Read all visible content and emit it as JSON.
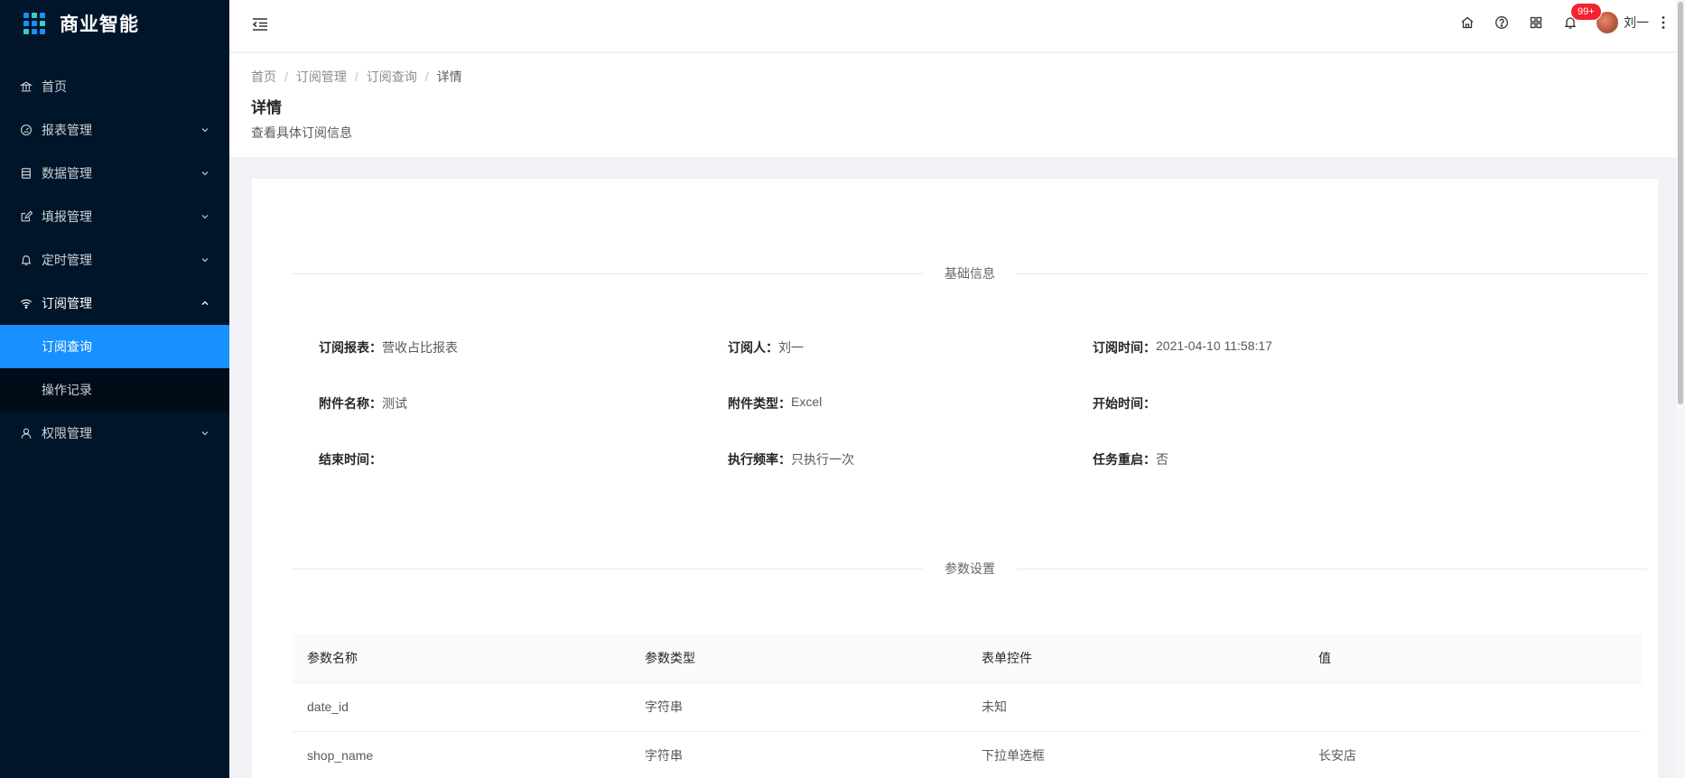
{
  "app": {
    "title": "商业智能"
  },
  "sidebar": {
    "items": [
      {
        "label": "首页",
        "icon": "bank-icon"
      },
      {
        "label": "报表管理",
        "icon": "dashboard-icon"
      },
      {
        "label": "数据管理",
        "icon": "database-icon"
      },
      {
        "label": "填报管理",
        "icon": "form-icon"
      },
      {
        "label": "定时管理",
        "icon": "bell-icon"
      },
      {
        "label": "订阅管理",
        "icon": "wifi-icon"
      },
      {
        "label": "权限管理",
        "icon": "user-icon"
      }
    ],
    "subitems": [
      {
        "label": "订阅查询"
      },
      {
        "label": "操作记录"
      }
    ]
  },
  "header": {
    "notification_count": "99+",
    "user_name": "刘一"
  },
  "breadcrumb": [
    "首页",
    "订阅管理",
    "订阅查询",
    "详情"
  ],
  "page": {
    "title": "详情",
    "description": "查看具体订阅信息"
  },
  "basic_info": {
    "section_title": "基础信息",
    "fields": [
      {
        "label": "订阅报表：",
        "value": "营收占比报表"
      },
      {
        "label": "订阅人：",
        "value": "刘一"
      },
      {
        "label": "订阅时间：",
        "value": "2021-04-10 11:58:17"
      },
      {
        "label": "附件名称：",
        "value": "测试"
      },
      {
        "label": "附件类型：",
        "value": "Excel"
      },
      {
        "label": "开始时间：",
        "value": ""
      },
      {
        "label": "结束时间：",
        "value": ""
      },
      {
        "label": "执行频率：",
        "value": "只执行一次"
      },
      {
        "label": "任务重启：",
        "value": "否"
      }
    ]
  },
  "params": {
    "section_title": "参数设置",
    "columns": [
      "参数名称",
      "参数类型",
      "表单控件",
      "值"
    ],
    "rows": [
      [
        "date_id",
        "字符串",
        "未知",
        ""
      ],
      [
        "shop_name",
        "字符串",
        "下拉单选框",
        "长安店"
      ]
    ]
  },
  "colors": {
    "sidebar_bg": "#001529",
    "active_bg": "#1890ff",
    "badge": "#f5222d"
  }
}
